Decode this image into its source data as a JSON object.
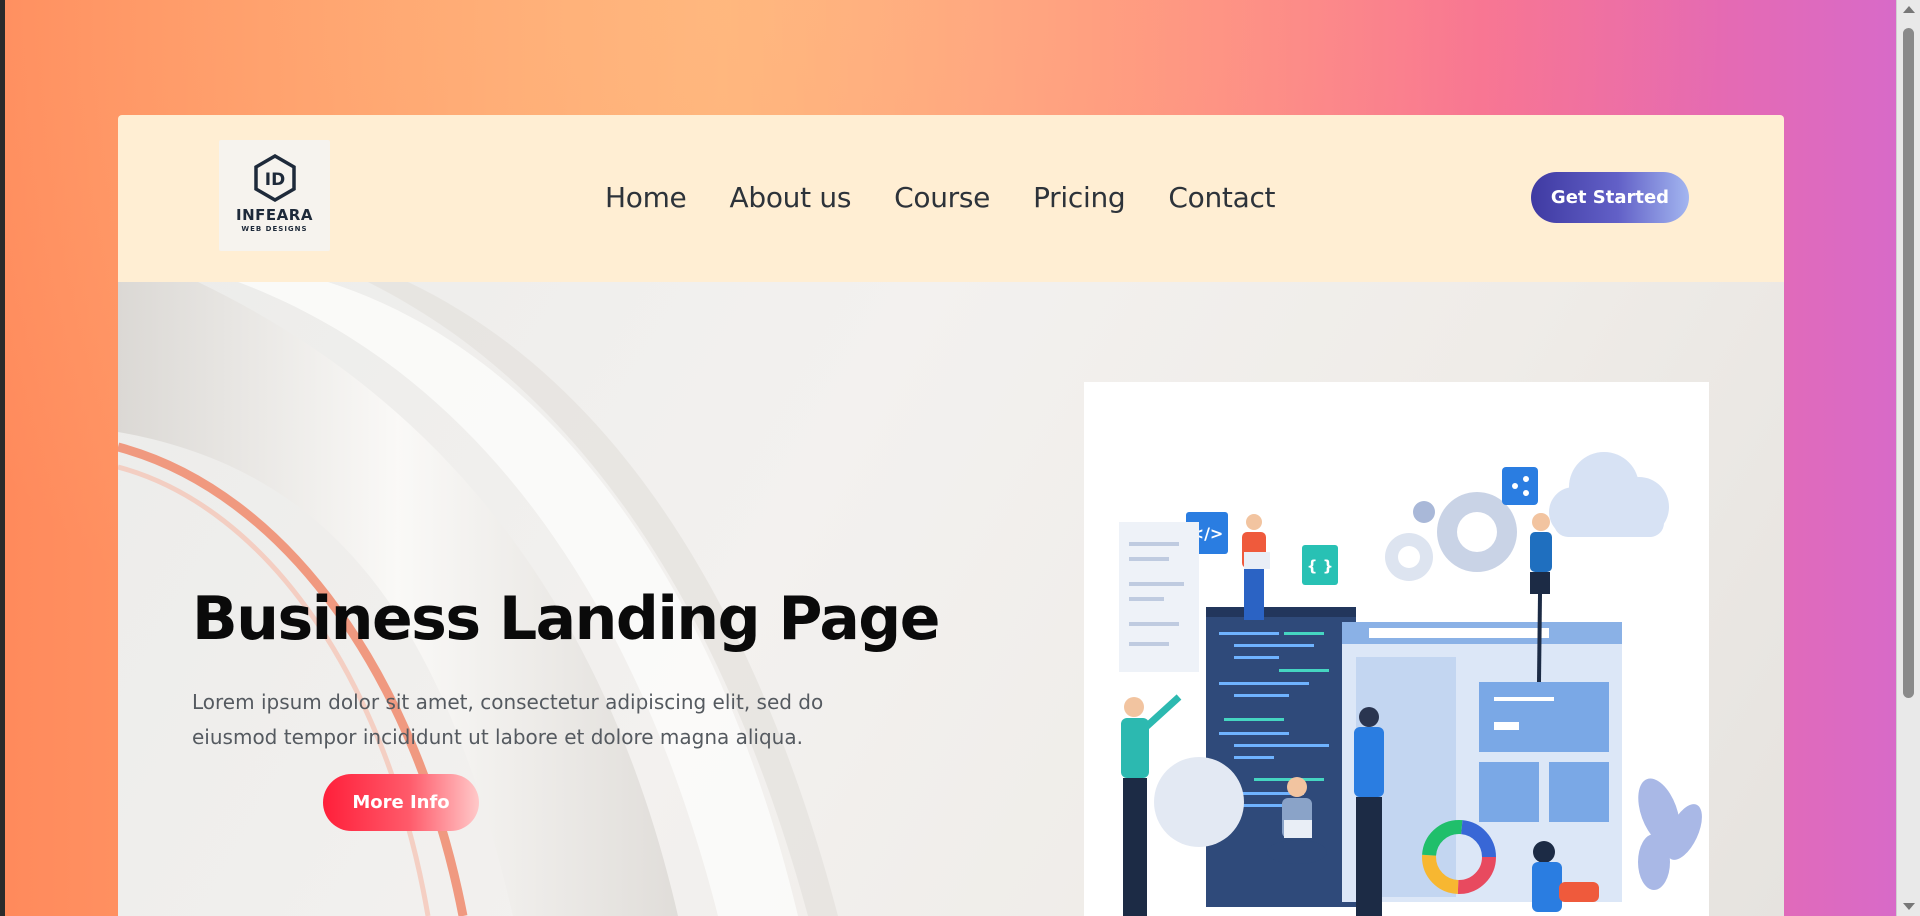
{
  "brand": {
    "name": "INFEARA",
    "tagline": "WEB DESIGNS",
    "monogram": "ID"
  },
  "nav": {
    "items": [
      {
        "label": "Home"
      },
      {
        "label": "About us"
      },
      {
        "label": "Course"
      },
      {
        "label": "Pricing"
      },
      {
        "label": "Contact"
      }
    ],
    "cta_label": "Get Started"
  },
  "hero": {
    "title": "Business Landing Page",
    "text": "Lorem ipsum dolor sit amet, consectetur adipiscing elit, sed do eiusmod tempor incididunt ut labore et dolore magna aliqua.",
    "button_label": "More Info"
  },
  "illustration": {
    "code_badge": "</>",
    "brace_badge": "{ }"
  },
  "colors": {
    "page_gradient": [
      "#ff8a5c",
      "#ffb07a",
      "#f76b95",
      "#d86ac8"
    ],
    "navbar_bg": "#ffeed3",
    "cta_gradient": [
      "#3f3aa2",
      "#a3b6f0"
    ],
    "more_info_gradient": [
      "#ff1f3a",
      "#ffc9c9"
    ]
  }
}
